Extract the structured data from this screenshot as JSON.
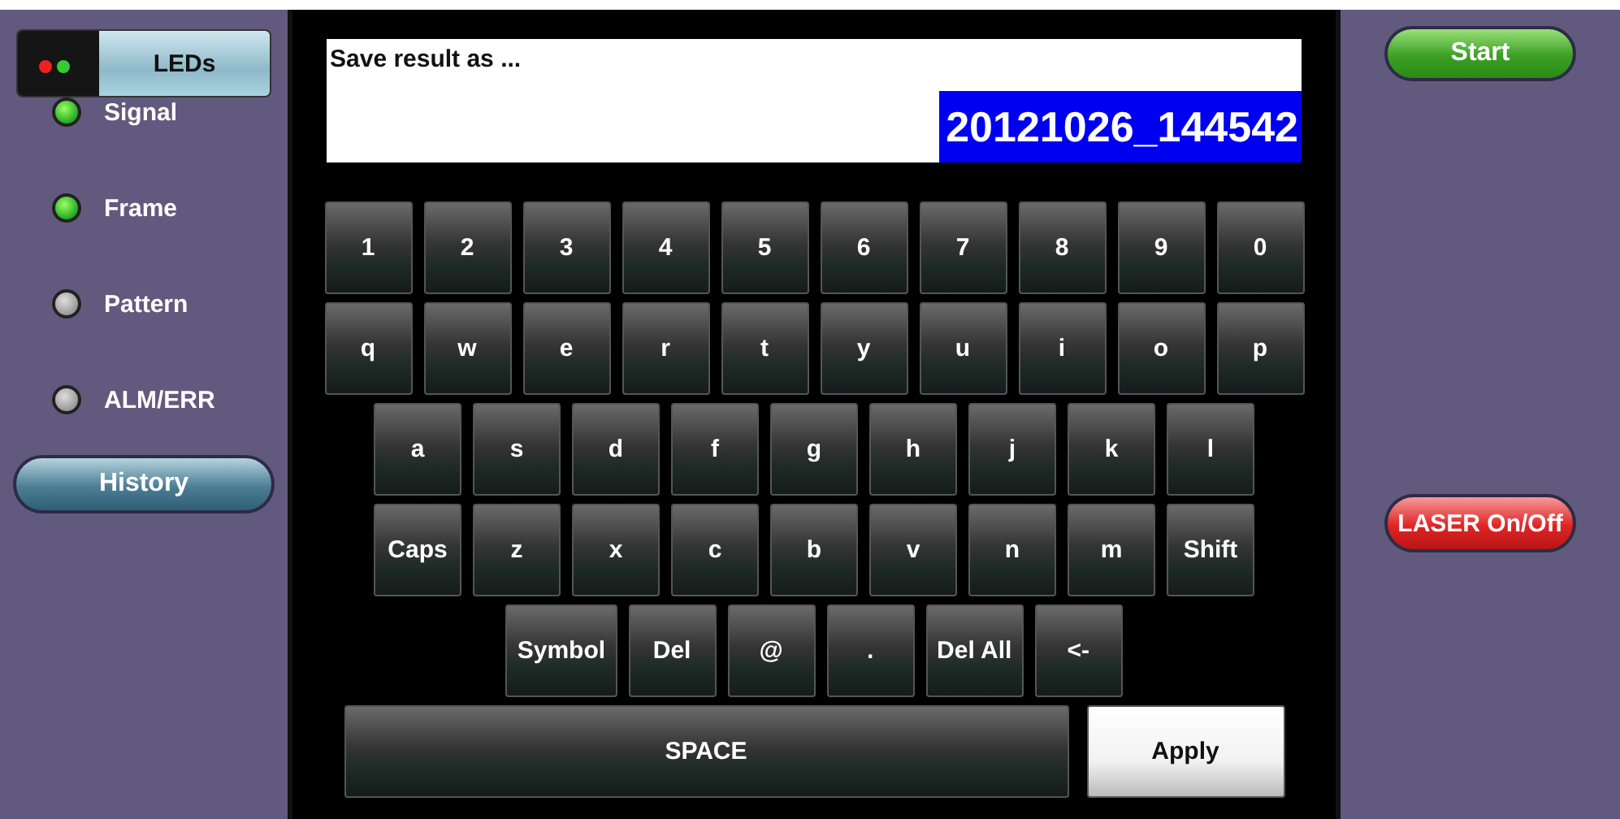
{
  "left_panel": {
    "leds_tab": {
      "label": "LEDs"
    },
    "leds": [
      {
        "label": "Signal",
        "on": true
      },
      {
        "label": "Frame",
        "on": true
      },
      {
        "label": "Pattern",
        "on": false
      },
      {
        "label": "ALM/ERR",
        "on": false
      }
    ],
    "history_button": "History"
  },
  "save_field": {
    "label": "Save result as ...",
    "value": "20121026_144542",
    "selected": true
  },
  "keyboard": {
    "rows": [
      [
        {
          "label": "1"
        },
        {
          "label": "2"
        },
        {
          "label": "3"
        },
        {
          "label": "4"
        },
        {
          "label": "5"
        },
        {
          "label": "6"
        },
        {
          "label": "7"
        },
        {
          "label": "8"
        },
        {
          "label": "9"
        },
        {
          "label": "0"
        }
      ],
      [
        {
          "label": "q"
        },
        {
          "label": "w"
        },
        {
          "label": "e"
        },
        {
          "label": "r"
        },
        {
          "label": "t"
        },
        {
          "label": "y"
        },
        {
          "label": "u"
        },
        {
          "label": "i"
        },
        {
          "label": "o"
        },
        {
          "label": "p"
        }
      ],
      [
        {
          "label": "a"
        },
        {
          "label": "s"
        },
        {
          "label": "d"
        },
        {
          "label": "f"
        },
        {
          "label": "g"
        },
        {
          "label": "h"
        },
        {
          "label": "j"
        },
        {
          "label": "k"
        },
        {
          "label": "l"
        }
      ],
      [
        {
          "label": "Caps"
        },
        {
          "label": "z"
        },
        {
          "label": "x"
        },
        {
          "label": "c"
        },
        {
          "label": "b"
        },
        {
          "label": "v"
        },
        {
          "label": "n"
        },
        {
          "label": "m"
        },
        {
          "label": "Shift"
        }
      ],
      [
        {
          "label": "Symbol"
        },
        {
          "label": "Del"
        },
        {
          "label": "@"
        },
        {
          "label": "."
        },
        {
          "label": "Del All"
        },
        {
          "label": "<-"
        }
      ]
    ],
    "space_key": "SPACE",
    "apply_button": "Apply"
  },
  "right_panel": {
    "start_button": "Start",
    "laser_button": "LASER On/Off"
  }
}
